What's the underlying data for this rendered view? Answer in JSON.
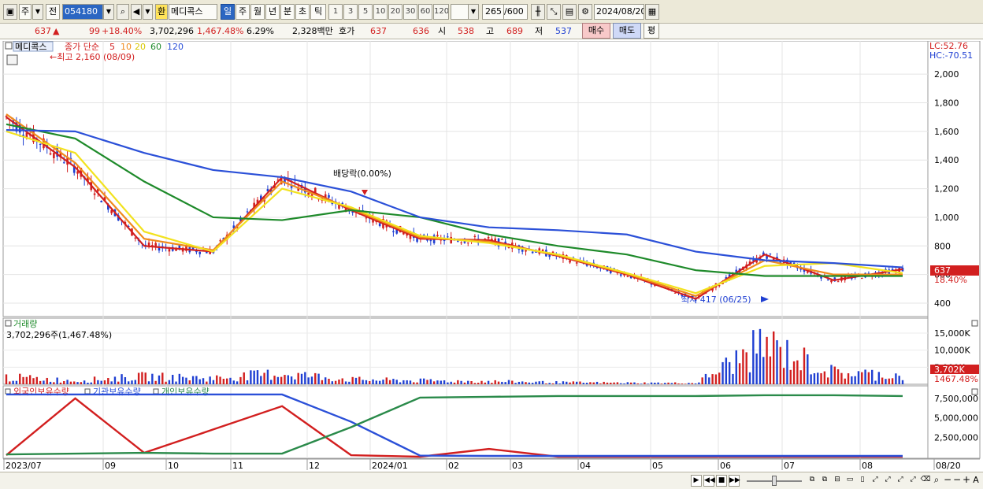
{
  "toolbar": {
    "type_label": "주",
    "prev_label": "전",
    "code": "054180",
    "badge": "환",
    "name": "메디콕스",
    "periods": [
      "일",
      "주",
      "월",
      "년",
      "분",
      "초",
      "틱"
    ],
    "minutes": [
      "1",
      "3",
      "5",
      "10",
      "20",
      "30",
      "60",
      "120"
    ],
    "count": "265",
    "count_total": "/600",
    "date": "2024/08/20"
  },
  "info": {
    "price": "637",
    "change_arrow": "▲",
    "change": "99",
    "change_pct": "+18.40%",
    "volume": "3,702,296",
    "volume_pct": "1,467.48%",
    "turnover_pct": "6.29%",
    "amount": "2,328백만",
    "quote_label": "호가",
    "ask": "637",
    "bid": "636",
    "open_label": "시",
    "open": "538",
    "high_label": "고",
    "high": "689",
    "low_label": "저",
    "low": "537",
    "buy_label": "매수",
    "sell_label": "매도",
    "avg_label": "평"
  },
  "price_panel": {
    "stock_tag": "메디콕스",
    "ma_label": "종가 단순",
    "ma_periods": [
      "5",
      "10",
      "20",
      "60",
      "120"
    ],
    "ma_colors": [
      "#d21f1f",
      "#f08a1c",
      "#f2e21e",
      "#1e8a2a",
      "#2b50d8"
    ],
    "high_note": "←최고 2,160 (08/09)",
    "low_note": "최저 417 (06/25)",
    "div_note": "배당락(0.00%)",
    "lc": "LC:52.76",
    "hc": "HC:-70.51",
    "last_price": "637",
    "last_pct": "18.40%"
  },
  "volume_panel": {
    "title": "거래량",
    "value": "3,702,296주(1,467.48%)",
    "last": "3,702K",
    "last_pct": "1467.48%"
  },
  "holdings_panel": {
    "legend": [
      "외국인보유수량",
      "기관보유수량",
      "개인보유수량"
    ]
  },
  "x_labels": [
    "2023/07",
    "09",
    "10",
    "11",
    "12",
    "2024/01",
    "02",
    "03",
    "04",
    "05",
    "06",
    "07",
    "08",
    "08/20"
  ],
  "chart_data": [
    {
      "type": "line",
      "title": "메디콕스",
      "ylabel": "",
      "ylim": [
        400,
        2160
      ],
      "y_ticks": [
        400,
        600,
        800,
        1000,
        1200,
        1400,
        1600,
        1800,
        2000
      ],
      "x": [
        "2023/07",
        "09",
        "10",
        "11",
        "12",
        "2024/01",
        "02",
        "03",
        "04",
        "05",
        "06",
        "07",
        "08",
        "08/20"
      ],
      "series": [
        {
          "name": "5",
          "color": "#d21f1f",
          "values": [
            1700,
            1350,
            800,
            760,
            1280,
            1050,
            850,
            840,
            730,
            600,
            430,
            740,
            560,
            637
          ]
        },
        {
          "name": "10",
          "color": "#f08a1c",
          "values": [
            1720,
            1380,
            850,
            770,
            1250,
            1060,
            860,
            830,
            735,
            605,
            450,
            700,
            600,
            600
          ]
        },
        {
          "name": "20",
          "color": "#f2e21e",
          "values": [
            1600,
            1450,
            900,
            760,
            1200,
            1070,
            870,
            820,
            740,
            610,
            470,
            660,
            680,
            610
          ]
        },
        {
          "name": "60",
          "color": "#1e8a2a",
          "values": [
            1650,
            1550,
            1250,
            1000,
            980,
            1050,
            1000,
            880,
            800,
            740,
            630,
            590,
            590,
            590
          ]
        },
        {
          "name": "120",
          "color": "#2b50d8",
          "values": [
            1610,
            1600,
            1450,
            1330,
            1280,
            1180,
            1000,
            930,
            910,
            880,
            760,
            700,
            680,
            650
          ]
        }
      ],
      "events": {
        "high": 2160,
        "low": 417,
        "last": 637
      }
    },
    {
      "type": "bar",
      "title": "거래량",
      "ylim": [
        0,
        18000
      ],
      "y_ticks": [
        "15,000K",
        "10,000K",
        "5,000K"
      ],
      "x": [
        "2023/07",
        "09",
        "10",
        "11",
        "12",
        "2024/01",
        "02",
        "03",
        "04",
        "05",
        "06",
        "07",
        "08",
        "08/20"
      ],
      "values": [
        3000,
        1500,
        3200,
        2500,
        4500,
        2000,
        1500,
        1200,
        800,
        600,
        500,
        16500,
        4800,
        3702
      ]
    },
    {
      "type": "line",
      "title": "보유수량",
      "y_ticks": [
        "7,500,000",
        "5,000,000",
        "2,500,000"
      ],
      "series": [
        {
          "name": "외국인보유수량",
          "color": "#d21f1f",
          "values": [
            200000,
            7500000,
            500000,
            3500000,
            6500000,
            200000,
            0,
            1000000,
            0,
            0,
            0,
            0,
            0,
            0
          ]
        },
        {
          "name": "기관보유수량",
          "color": "#2b50d8",
          "values": [
            8000000,
            8000000,
            8000000,
            8000000,
            8000000,
            4500000,
            150000,
            100000,
            100000,
            100000,
            100000,
            100000,
            100000,
            100000
          ]
        },
        {
          "name": "개인보유수량",
          "color": "#2a8a4a",
          "values": [
            300000,
            400000,
            500000,
            400000,
            400000,
            3800000,
            7600000,
            7700000,
            7800000,
            7800000,
            7800000,
            7900000,
            7900000,
            7800000
          ]
        }
      ]
    }
  ]
}
